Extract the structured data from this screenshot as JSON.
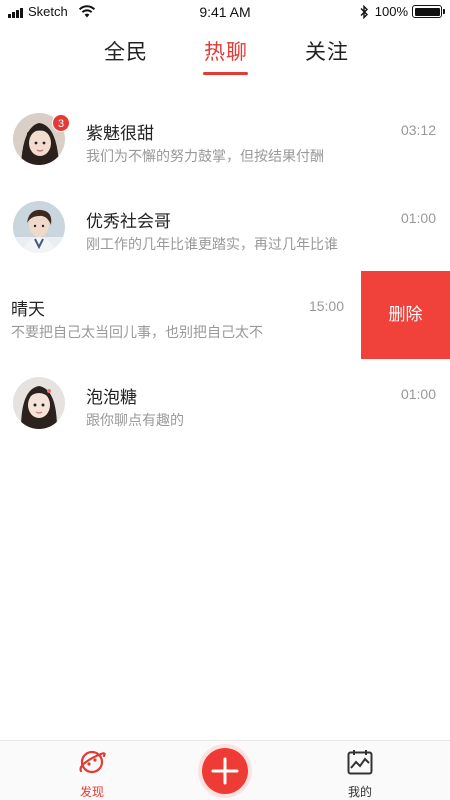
{
  "status_bar": {
    "carrier": "Sketch",
    "time": "9:41 AM",
    "battery": "100%",
    "battery_level": 1.0
  },
  "tabs": [
    {
      "label": "全民"
    },
    {
      "label": "热聊"
    },
    {
      "label": "关注"
    }
  ],
  "active_tab": "热聊",
  "chats": [
    {
      "name": "紫魅很甜",
      "message": "我们为不懈的努力鼓掌，但按结果付酬",
      "time": "03:12",
      "unread": "3",
      "avatar": "girl-avatar"
    },
    {
      "name": "优秀社会哥",
      "message": "刚工作的几年比谁更踏实，再过几年比谁",
      "time": "01:00",
      "avatar": "boy-avatar"
    },
    {
      "name": "晴天",
      "message": "不要把自己太当回儿事，也别把自己太不",
      "time": "15:00",
      "delete_label": "删除"
    },
    {
      "name": "泡泡糖",
      "message": "跟你聊点有趣的",
      "time": "01:00",
      "avatar": "girl-avatar-2"
    }
  ],
  "bottom_nav": {
    "discover": {
      "label": "发现",
      "icon": "planet-icon"
    },
    "add": {
      "icon": "plus-icon"
    },
    "mine": {
      "label": "我的",
      "icon": "calendar-chart-icon"
    }
  },
  "colors": {
    "accent": "#e53935",
    "delete_bg": "#f0413b",
    "muted_text": "#999999"
  }
}
